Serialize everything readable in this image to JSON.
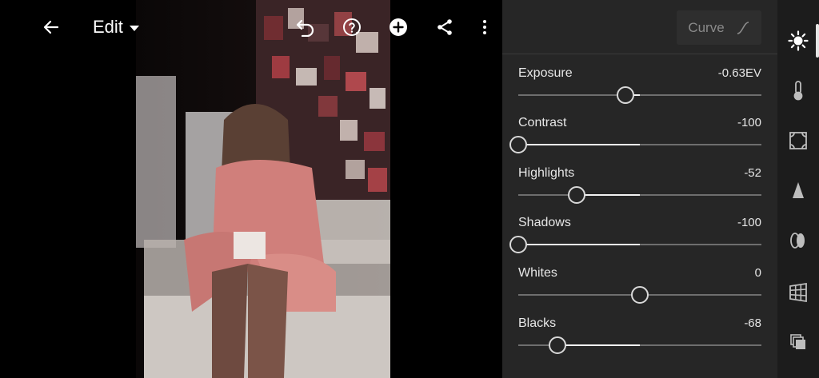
{
  "toolbar": {
    "mode_label": "Edit",
    "icons": [
      "back-arrow-icon",
      "caret-down-icon",
      "undo-icon",
      "help-icon",
      "add-icon",
      "share-icon",
      "more-vertical-icon"
    ]
  },
  "panel": {
    "curve_label": "Curve",
    "sliders": [
      {
        "label": "Exposure",
        "value": "-0.63EV",
        "position": 0.44
      },
      {
        "label": "Contrast",
        "value": "-100",
        "position": 0.0
      },
      {
        "label": "Highlights",
        "value": "-52",
        "position": 0.24
      },
      {
        "label": "Shadows",
        "value": "-100",
        "position": 0.0
      },
      {
        "label": "Whites",
        "value": "0",
        "position": 0.5
      },
      {
        "label": "Blacks",
        "value": "-68",
        "position": 0.16
      }
    ]
  },
  "tool_strip": [
    "light-icon",
    "color-temperature-icon",
    "effects-icon",
    "detail-icon",
    "optics-icon",
    "geometry-icon",
    "presets-icon"
  ],
  "colors": {
    "panel_bg": "#262626",
    "strip_bg": "#1c1c1c",
    "accent": "#ffffff"
  }
}
